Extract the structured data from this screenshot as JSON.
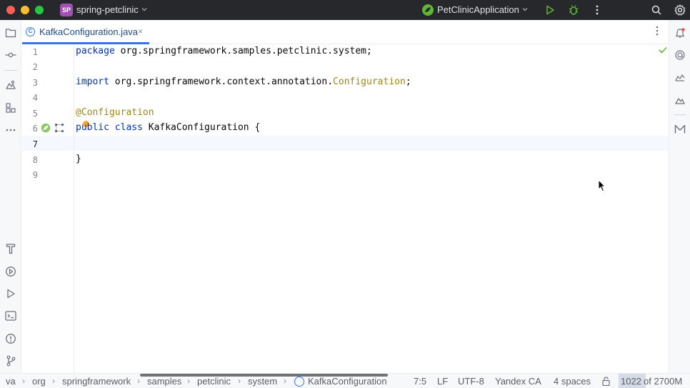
{
  "titlebar": {
    "project_badge": "SP",
    "project_name": "spring-petclinic",
    "run_config": "PetClinicApplication",
    "icons": [
      "run-icon",
      "debug-icon",
      "more-vertical-icon",
      "search-icon",
      "settings-icon"
    ]
  },
  "tab": {
    "label": "KafkaConfiguration.java",
    "icon_glyph": "C",
    "close_glyph": "×"
  },
  "editor": {
    "line_numbers": [
      "1",
      "2",
      "3",
      "4",
      "5",
      "6",
      "7",
      "8",
      "9"
    ],
    "current_line": "7",
    "lines": [
      {
        "kw": "package",
        "rest": " org.springframework.samples.petclinic.system;"
      },
      {},
      {
        "kw": "import",
        "rest": " org.springframework.context.annotation.",
        "ann": "Configuration",
        "tail": ";"
      },
      {},
      {
        "ann_only": "@Configuration"
      },
      {
        "kw": "public class",
        "rest": " KafkaConfiguration {"
      },
      {},
      {
        "text": "}"
      },
      {}
    ]
  },
  "statusbar": {
    "breadcrumbs": [
      "va",
      "org",
      "springframework",
      "samples",
      "petclinic",
      "system",
      "KafkaConfiguration"
    ],
    "position": "7:5",
    "line_separator": "LF",
    "encoding": "UTF-8",
    "code_style": "Yandex CA",
    "indent": "4 spaces",
    "memory_used": "1022",
    "memory_total": "of 2700M"
  },
  "colors": {
    "accent": "#3574f0",
    "keyword": "#0033b3",
    "annotation": "#9e880d",
    "titlebar_bg": "#27282c"
  }
}
